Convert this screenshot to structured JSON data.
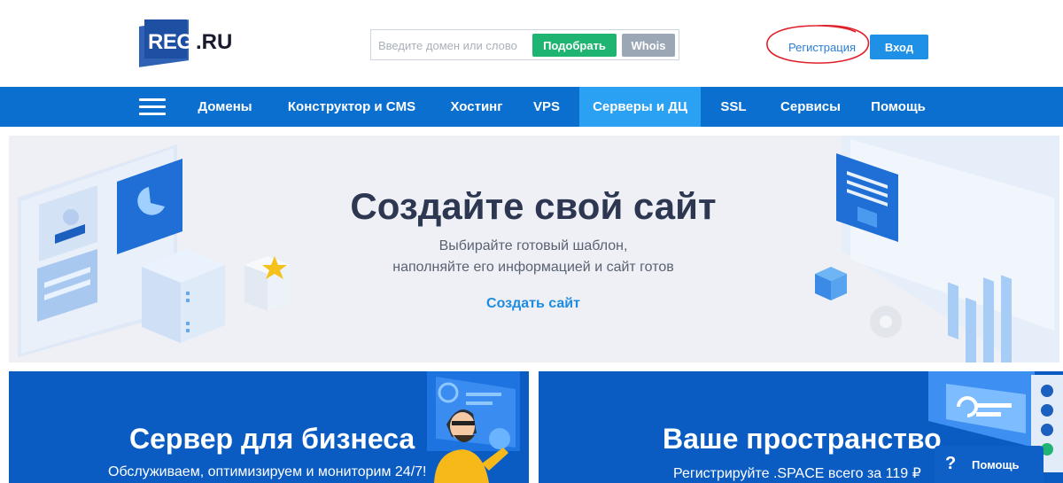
{
  "header": {
    "logo_text_main": "REG",
    "logo_text_tld": ".RU",
    "search_placeholder": "Введите домен или слово",
    "pick_button": "Подобрать",
    "whois_button": "Whois",
    "register_link": "Регистрация",
    "login_button": "Вход"
  },
  "nav": {
    "items": [
      {
        "label": "Домены"
      },
      {
        "label": "Конструктор и CMS"
      },
      {
        "label": "Хостинг"
      },
      {
        "label": "VPS"
      },
      {
        "label": "Серверы и ДЦ"
      },
      {
        "label": "SSL"
      },
      {
        "label": "Сервисы"
      },
      {
        "label": "Помощь"
      }
    ],
    "active_index": 4
  },
  "hero": {
    "title": "Создайте свой сайт",
    "subtitle_line1": "Выбирайте готовый шаблон,",
    "subtitle_line2": "наполняйте его информацией и сайт готов",
    "cta": "Создать сайт"
  },
  "cards": [
    {
      "title": "Сервер для бизнеса",
      "subtitle": "Обслуживаем, оптимизируем и мониторим 24/7!"
    },
    {
      "title": "Ваше пространство",
      "subtitle": "Регистрируйте .SPACE всего за 119 ₽"
    }
  ],
  "help_widget": {
    "icon": "?",
    "label": "Помощь"
  },
  "colors": {
    "brand_blue": "#0a6fce",
    "active_tab": "#2aa1f2",
    "pick_green": "#1fb472",
    "annotation_red": "#e0202a"
  }
}
